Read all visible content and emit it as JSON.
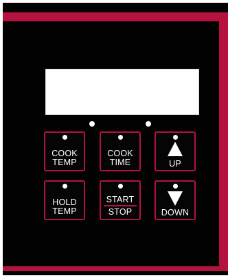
{
  "colors": {
    "accent": "#b5123f",
    "panel": "#020202",
    "display": "#ffffff",
    "text": "#ffffff"
  },
  "display": {
    "text": ""
  },
  "buttons": {
    "cook_temp": {
      "line1": "COOK",
      "line2": "TEMP"
    },
    "cook_time": {
      "line1": "COOK",
      "line2": "TIME"
    },
    "up": {
      "label": "UP",
      "icon": "arrow-up-icon"
    },
    "hold_temp": {
      "line1": "HOLD",
      "line2": "TEMP"
    },
    "start_stop": {
      "start": "START",
      "stop": "STOP"
    },
    "down": {
      "label": "DOWN",
      "icon": "arrow-down-icon"
    }
  }
}
